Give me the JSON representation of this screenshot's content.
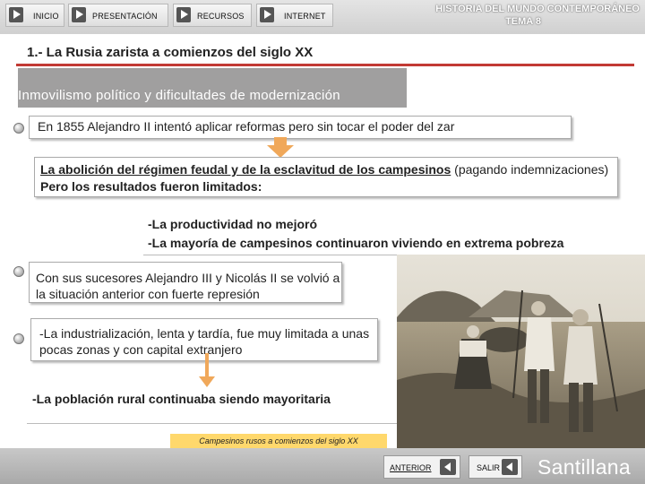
{
  "nav": {
    "inicio": "INICIO",
    "presentacion": "PRESENTACIÓN",
    "recursos": "RECURSOS",
    "internet": "INTERNET"
  },
  "header": {
    "title": "HISTORIA DEL MUNDO CONTEMPORÁNEO",
    "subtitle": "TEMA 8"
  },
  "section_title": "1.- La Rusia zarista a comienzos del siglo XX",
  "subtitle": "Inmovilismo político y dificultades de modernización",
  "content": {
    "box1": "En 1855 Alejandro II intentó aplicar reformas pero sin tocar el poder del zar",
    "box2_underlined": "La abolición del régimen feudal y de la esclavitud de los campesinos",
    "box2_normal": " (pagando indemnizaciones) ",
    "box2_bold": "Pero los resultados fueron limitados:",
    "result1": "-La productividad no mejoró",
    "result2": "-La mayoría de campesinos continuaron viviendo en extrema pobreza",
    "box3": "Con sus sucesores Alejandro III y Nicolás II se volvió a la situación anterior con fuerte represión",
    "box4": "-La industrialización, lenta y tardía, fue muy limitada a unas pocas zonas y con capital extranjero",
    "result3": "-La población rural continuaba siendo mayoritaria"
  },
  "photo_caption": "Campesinos rusos a comienzos del siglo XX",
  "footer": {
    "anterior": "ANTERIOR",
    "salir": "SALIR",
    "brand": "Santillana"
  },
  "colors": {
    "accent_red": "#c23a34",
    "arrow_orange": "#f0a85a",
    "caption_yellow": "#ffd86c"
  }
}
